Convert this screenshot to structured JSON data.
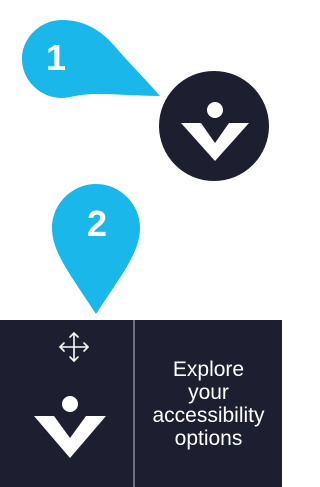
{
  "callouts": [
    {
      "number": "1"
    },
    {
      "number": "2"
    }
  ],
  "colors": {
    "callout": "#1ab7ea",
    "panel": "#1d1f30",
    "icon": "#ffffff",
    "divider": "#6b6e80"
  },
  "launcher": {
    "icon": "accessibility-logo-icon"
  },
  "toolbar": {
    "drag_icon": "move-arrows-icon",
    "logo_icon": "accessibility-logo-icon",
    "explore_label": "Explore\nyour\naccessibility\noptions"
  }
}
